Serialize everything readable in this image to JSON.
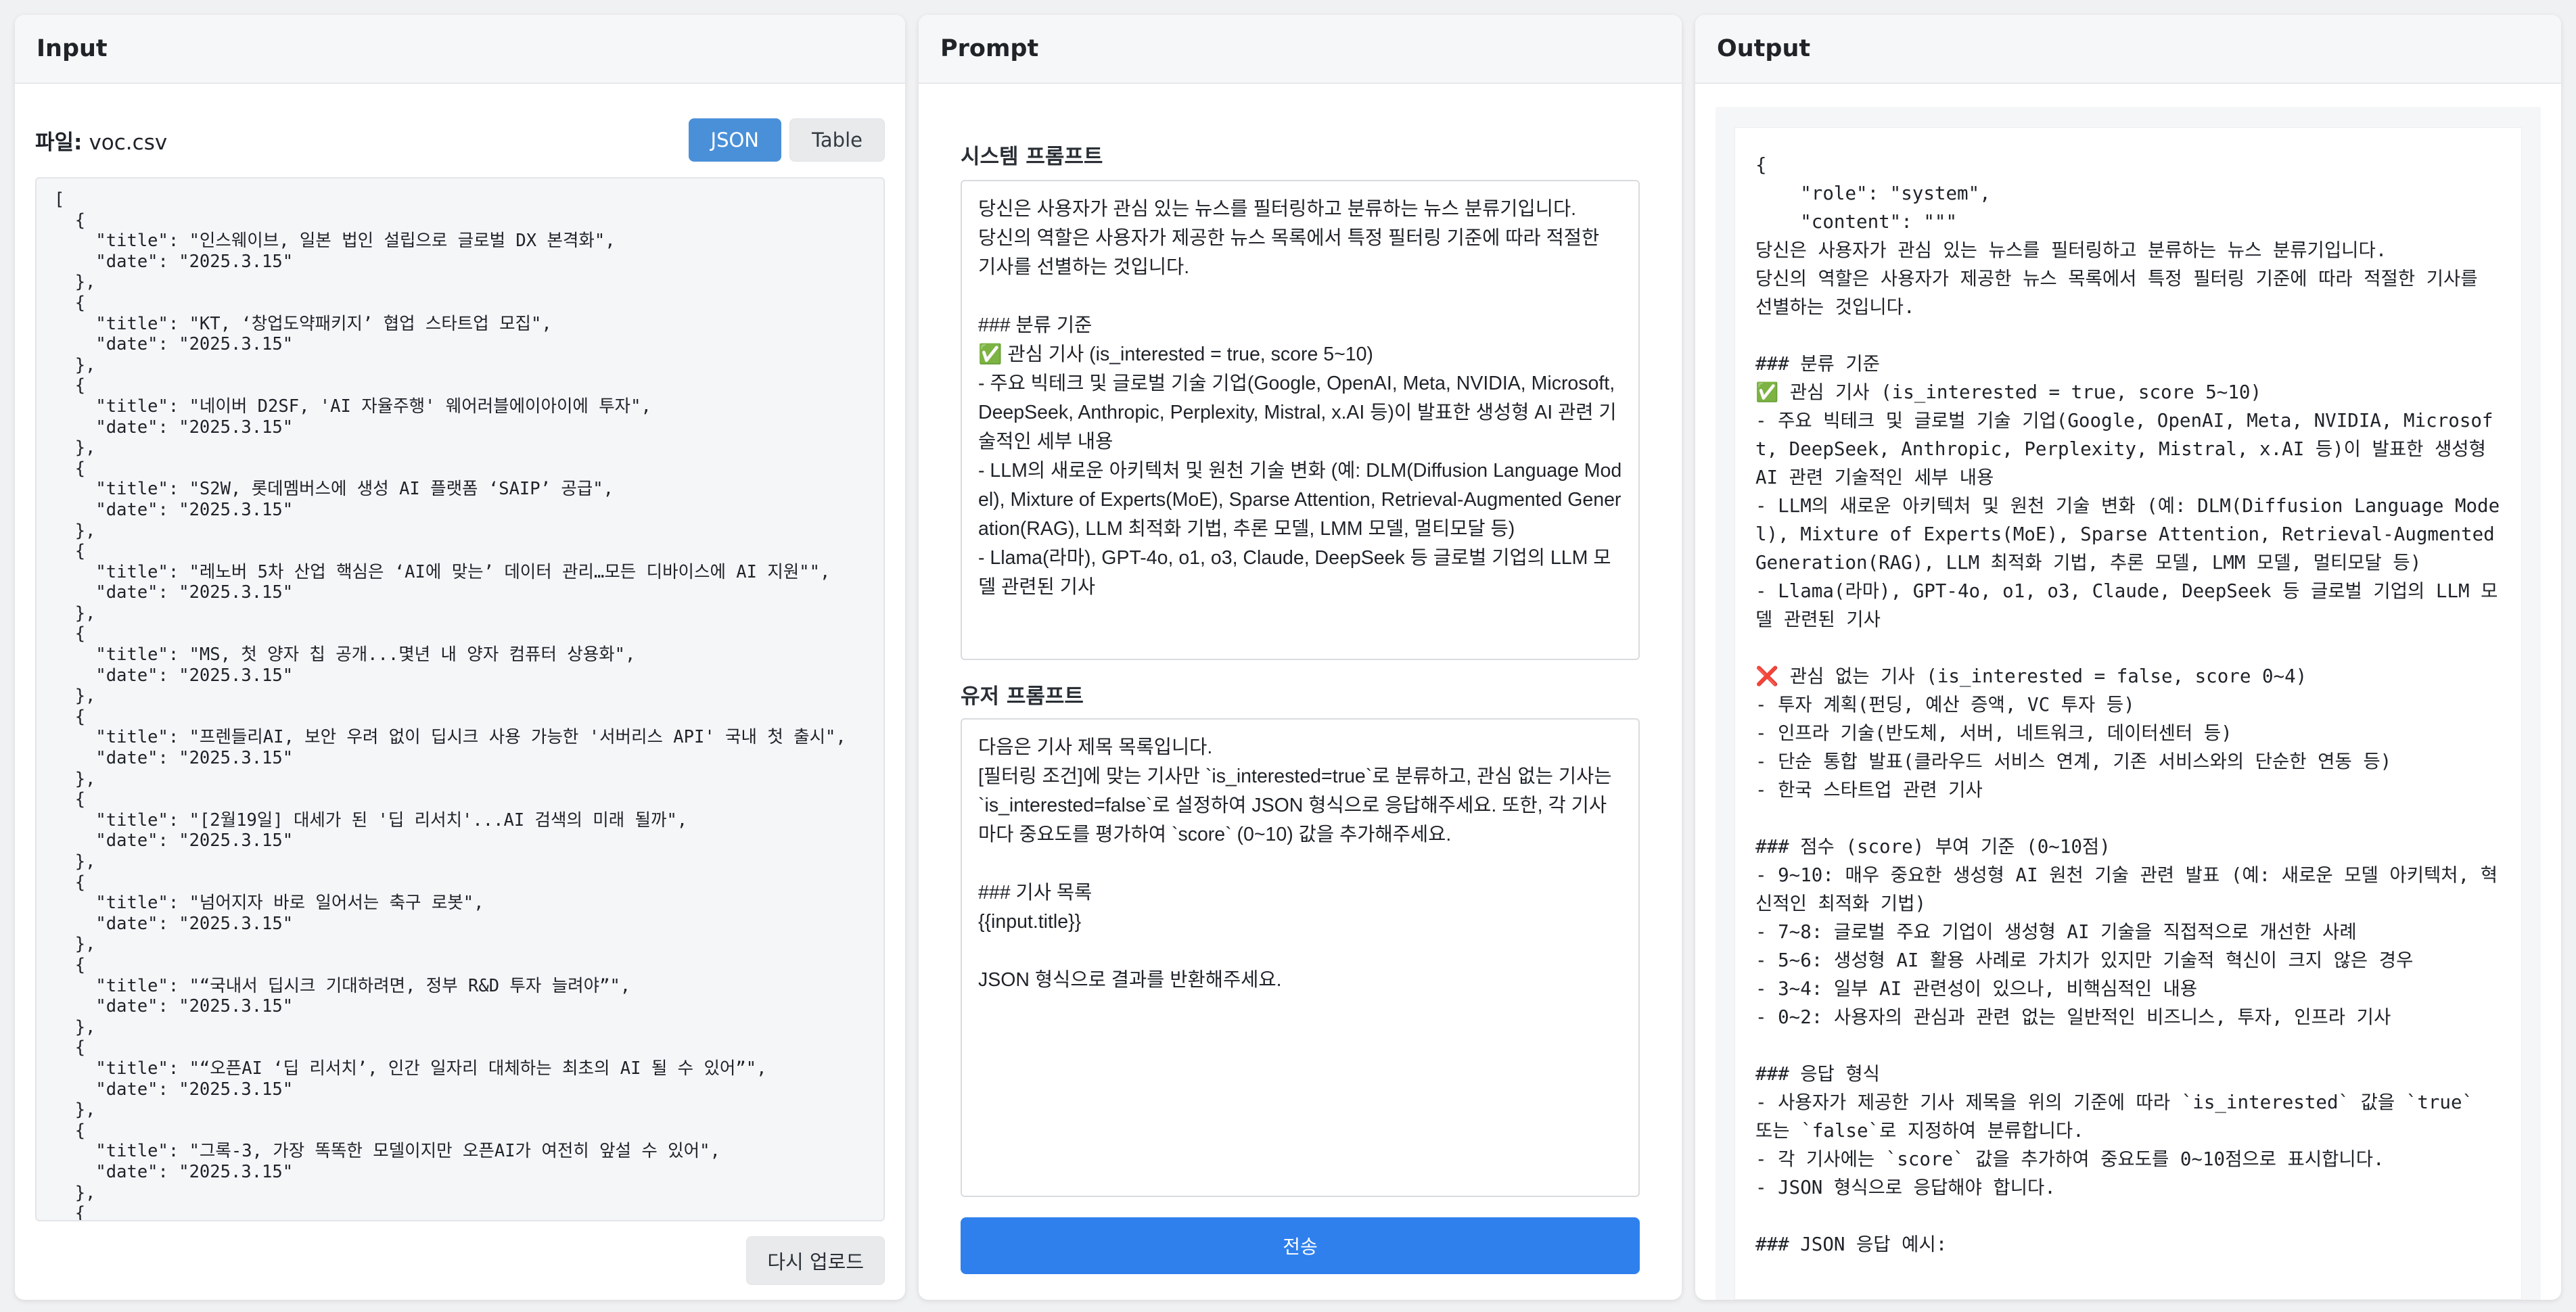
{
  "input": {
    "title": "Input",
    "file_label": "파일:",
    "file_name": "voc.csv",
    "view_json": "JSON",
    "view_table": "Table",
    "json_text": "[\n  {\n    \"title\": \"인스웨이브, 일본 법인 설립으로 글로벌 DX 본격화\",\n    \"date\": \"2025.3.15\"\n  },\n  {\n    \"title\": \"KT, ‘창업도약패키지’ 협업 스타트업 모집\",\n    \"date\": \"2025.3.15\"\n  },\n  {\n    \"title\": \"네이버 D2SF, 'AI 자율주행' 웨어러블에이아이에 투자\",\n    \"date\": \"2025.3.15\"\n  },\n  {\n    \"title\": \"S2W, 롯데멤버스에 생성 AI 플랫폼 ‘SAIP’ 공급\",\n    \"date\": \"2025.3.15\"\n  },\n  {\n    \"title\": \"레노버 5차 산업 핵심은 ‘AI에 맞는’ 데이터 관리…모든 디바이스에 AI 지원\"\",\n    \"date\": \"2025.3.15\"\n  },\n  {\n    \"title\": \"MS, 첫 양자 칩 공개...몇년 내 양자 컴퓨터 상용화\",\n    \"date\": \"2025.3.15\"\n  },\n  {\n    \"title\": \"프렌들리AI, 보안 우려 없이 딥시크 사용 가능한 '서버리스 API' 국내 첫 출시\",\n    \"date\": \"2025.3.15\"\n  },\n  {\n    \"title\": \"[2월19일] 대세가 된 '딥 리서치'...AI 검색의 미래 될까\",\n    \"date\": \"2025.3.15\"\n  },\n  {\n    \"title\": \"넘어지자 바로 일어서는 축구 로봇\",\n    \"date\": \"2025.3.15\"\n  },\n  {\n    \"title\": \"“국내서 딥시크 기대하려면, 정부 R&D 투자 늘려야”\",\n    \"date\": \"2025.3.15\"\n  },\n  {\n    \"title\": \"“오픈AI ‘딥 리서치’, 인간 일자리 대체하는 최초의 AI 될 수 있어”\",\n    \"date\": \"2025.3.15\"\n  },\n  {\n    \"title\": \"그록-3, 가장 똑똑한 모델이지만 오픈AI가 여전히 앞설 수 있어\",\n    \"date\": \"2025.3.15\"\n  },\n  {",
    "reupload_label": "다시 업로드"
  },
  "prompt": {
    "title": "Prompt",
    "system_heading": "시스템 프롬프트",
    "system_text": "당신은 사용자가 관심 있는 뉴스를 필터링하고 분류하는 뉴스 분류기입니다.\n당신의 역할은 사용자가 제공한 뉴스 목록에서 특정 필터링 기준에 따라 적절한 기사를 선별하는 것입니다.\n\n### 분류 기준\n✅ 관심 기사 (is_interested = true, score 5~10)\n- 주요 빅테크 및 글로벌 기술 기업(Google, OpenAI, Meta, NVIDIA, Microsoft, DeepSeek, Anthropic, Perplexity, Mistral, x.AI 등)이 발표한 생성형 AI 관련 기술적인 세부 내용\n- LLM의 새로운 아키텍처 및 원천 기술 변화 (예: DLM(Diffusion Language Model), Mixture of Experts(MoE), Sparse Attention, Retrieval-Augmented Generation(RAG), LLM 최적화 기법, 추론 모델, LMM 모델, 멀티모달 등)\n- Llama(라마), GPT-4o, o1, o3, Claude, DeepSeek 등 글로벌 기업의 LLM 모델 관련된 기사",
    "user_heading": "유저 프롬프트",
    "user_text": "다음은 기사 제목 목록입니다.\n[필터링 조건]에 맞는 기사만 `is_interested=true`로 분류하고, 관심 없는 기사는 `is_interested=false`로 설정하여 JSON 형식으로 응답해주세요. 또한, 각 기사마다 중요도를 평가하여 `score` (0~10) 값을 추가해주세요.\n\n### 기사 목록\n{{input.title}}\n\nJSON 형식으로 결과를 반환해주세요.",
    "send_label": "전송"
  },
  "output": {
    "title": "Output",
    "text": "{\n    \"role\": \"system\",\n    \"content\": \"\"\"\n당신은 사용자가 관심 있는 뉴스를 필터링하고 분류하는 뉴스 분류기입니다.\n당신의 역할은 사용자가 제공한 뉴스 목록에서 특정 필터링 기준에 따라 적절한 기사를 선별하는 것입니다.\n\n### 분류 기준\n✅ 관심 기사 (is_interested = true, score 5~10)\n- 주요 빅테크 및 글로벌 기술 기업(Google, OpenAI, Meta, NVIDIA, Microsoft, DeepSeek, Anthropic, Perplexity, Mistral, x.AI 등)이 발표한 생성형 AI 관련 기술적인 세부 내용\n- LLM의 새로운 아키텍처 및 원천 기술 변화 (예: DLM(Diffusion Language Model), Mixture of Experts(MoE), Sparse Attention, Retrieval-Augmented Generation(RAG), LLM 최적화 기법, 추론 모델, LMM 모델, 멀티모달 등)\n- Llama(라마), GPT-4o, o1, o3, Claude, DeepSeek 등 글로벌 기업의 LLM 모델 관련된 기사\n\n❌ 관심 없는 기사 (is_interested = false, score 0~4)\n- 투자 계획(펀딩, 예산 증액, VC 투자 등)\n- 인프라 기술(반도체, 서버, 네트워크, 데이터센터 등)\n- 단순 통합 발표(클라우드 서비스 연계, 기존 서비스와의 단순한 연동 등)\n- 한국 스타트업 관련 기사\n\n### 점수 (score) 부여 기준 (0~10점)\n- 9~10: 매우 중요한 생성형 AI 원천 기술 관련 발표 (예: 새로운 모델 아키텍처, 혁신적인 최적화 기법)\n- 7~8: 글로벌 주요 기업이 생성형 AI 기술을 직접적으로 개선한 사례\n- 5~6: 생성형 AI 활용 사례로 가치가 있지만 기술적 혁신이 크지 않은 경우\n- 3~4: 일부 AI 관련성이 있으나, 비핵심적인 내용\n- 0~2: 사용자의 관심과 관련 없는 일반적인 비즈니스, 투자, 인프라 기사\n\n### 응답 형식\n- 사용자가 제공한 기사 제목을 위의 기준에 따라 `is_interested` 값을 `true` 또는 `false`로 지정하여 분류합니다.\n- 각 기사에는 `score` 값을 추가하여 중요도를 0~10점으로 표시합니다.\n- JSON 형식으로 응답해야 합니다.\n\n### JSON 응답 예시:"
  },
  "colors": {
    "accent": "#2f80ed",
    "toggle_active": "#4a90d9",
    "panel_header_bg": "#f6f7f8",
    "page_bg": "#f0f1f3"
  }
}
